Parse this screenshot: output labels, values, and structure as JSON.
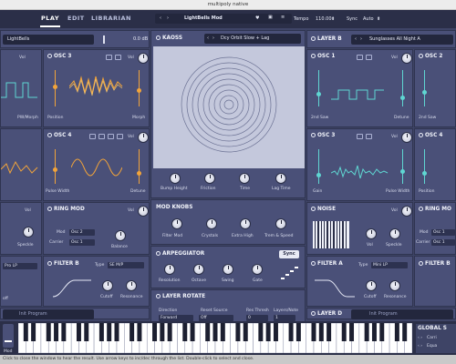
{
  "window": {
    "title": "multipoly native"
  },
  "topbar": {
    "tabs": [
      "PLAY",
      "EDIT",
      "LIBRARIAN"
    ],
    "preset_name": "LightBells Mod",
    "tempo_label": "Tempo",
    "tempo_value": "110.00",
    "sync_label": "Sync",
    "sync_value": "Auto"
  },
  "left": {
    "layer_preset": "LightBells",
    "volume_db": "0.0 dB",
    "osc_labels": {
      "pwm": "PW/Morph",
      "position": "Position",
      "morph": "Morph",
      "pulse_width": "Pulse Width",
      "detune": "Detune"
    },
    "osc3": {
      "title": "OSC 3",
      "vol": "Vol"
    },
    "osc4": {
      "title": "OSC 4",
      "vol": "Vol"
    },
    "speckle": "Speckle",
    "ring_mod": {
      "title": "RING MOD",
      "mod_label": "Mod",
      "mod_value": "Osc 2",
      "carrier_label": "Carrier",
      "carrier_value": "Osc 1",
      "balance": "Balance"
    },
    "filter_b": {
      "title": "FILTER B",
      "type_label": "Type",
      "type_value": "SE M/P",
      "cutoff": "Cutoff",
      "resonance": "Resonance"
    },
    "filter_left_type": "Pro LP",
    "off_label": "off",
    "init_program": "Init Program"
  },
  "center": {
    "kaoss": {
      "title": "KAOSS",
      "preset": "Dcy Orbit Slow + Lag",
      "knobs": [
        "Bump Height",
        "Friction",
        "Time",
        "Lag Time"
      ]
    },
    "mod_knobs": {
      "title": "MOD KNOBS",
      "knobs": [
        "Filter Mod",
        "Crystals",
        "Extra High",
        "Trem & Speed"
      ]
    },
    "arpeggiator": {
      "title": "ARPEGGIATOR",
      "sync": "Sync",
      "knobs": [
        "Resolution",
        "Octave",
        "Swing",
        "Gate"
      ]
    },
    "layer_rotate": {
      "title": "LAYER ROTATE",
      "direction_label": "Direction",
      "direction_value": "Forward",
      "reset_label": "Reset Source",
      "reset_value": "Off",
      "thresh_label": "Res Thresh",
      "thresh_value": "0",
      "layers_label": "Layers/Note",
      "layers_value": "1"
    }
  },
  "right": {
    "layer_b": {
      "title": "LAYER B",
      "preset": "Sunglasses All Night A"
    },
    "osc1": {
      "title": "OSC 1",
      "vol": "Vol",
      "left_label": "2nd Saw",
      "right_label": "Detune"
    },
    "osc2": {
      "title": "OSC 2",
      "vol": "Vol",
      "left_label": "2nd Saw"
    },
    "osc3": {
      "title": "OSC 3",
      "vol": "Vol",
      "left_label": "Gain",
      "right_label": "Pulse Width"
    },
    "osc4": {
      "title": "OSC 4",
      "left_label": "Position"
    },
    "noise": {
      "title": "NOISE",
      "vol": "Vol",
      "speckle": "Speckle"
    },
    "ring_mod": {
      "title": "RING MO",
      "mod_label": "Mod",
      "mod_value": "Osc 1",
      "carrier_label": "Carrier",
      "carrier_value": "Osc 1"
    },
    "filter_a": {
      "title": "FILTER A",
      "type_label": "Type",
      "type_value": "Mini LP",
      "cutoff": "Cutoff",
      "resonance": "Resonance"
    },
    "filter_b": {
      "title": "FILTER B"
    },
    "layer_d": {
      "title": "LAYER D"
    },
    "init_program": "Init Program"
  },
  "keyboard": {
    "mod_label": "Mod",
    "global_title": "GLOBAL S",
    "global_items": [
      "Carri",
      "Equa"
    ]
  },
  "status": {
    "text": "Click to close the window to hear the result. Use arrow keys to inc/dec through the list. Double-click to select and close."
  },
  "colors": {
    "background": "#3e4466",
    "panel": "#4a5078",
    "accent_orange": "#f2a43a",
    "accent_teal": "#5fd6d2",
    "topbar": "#2b2f48"
  }
}
